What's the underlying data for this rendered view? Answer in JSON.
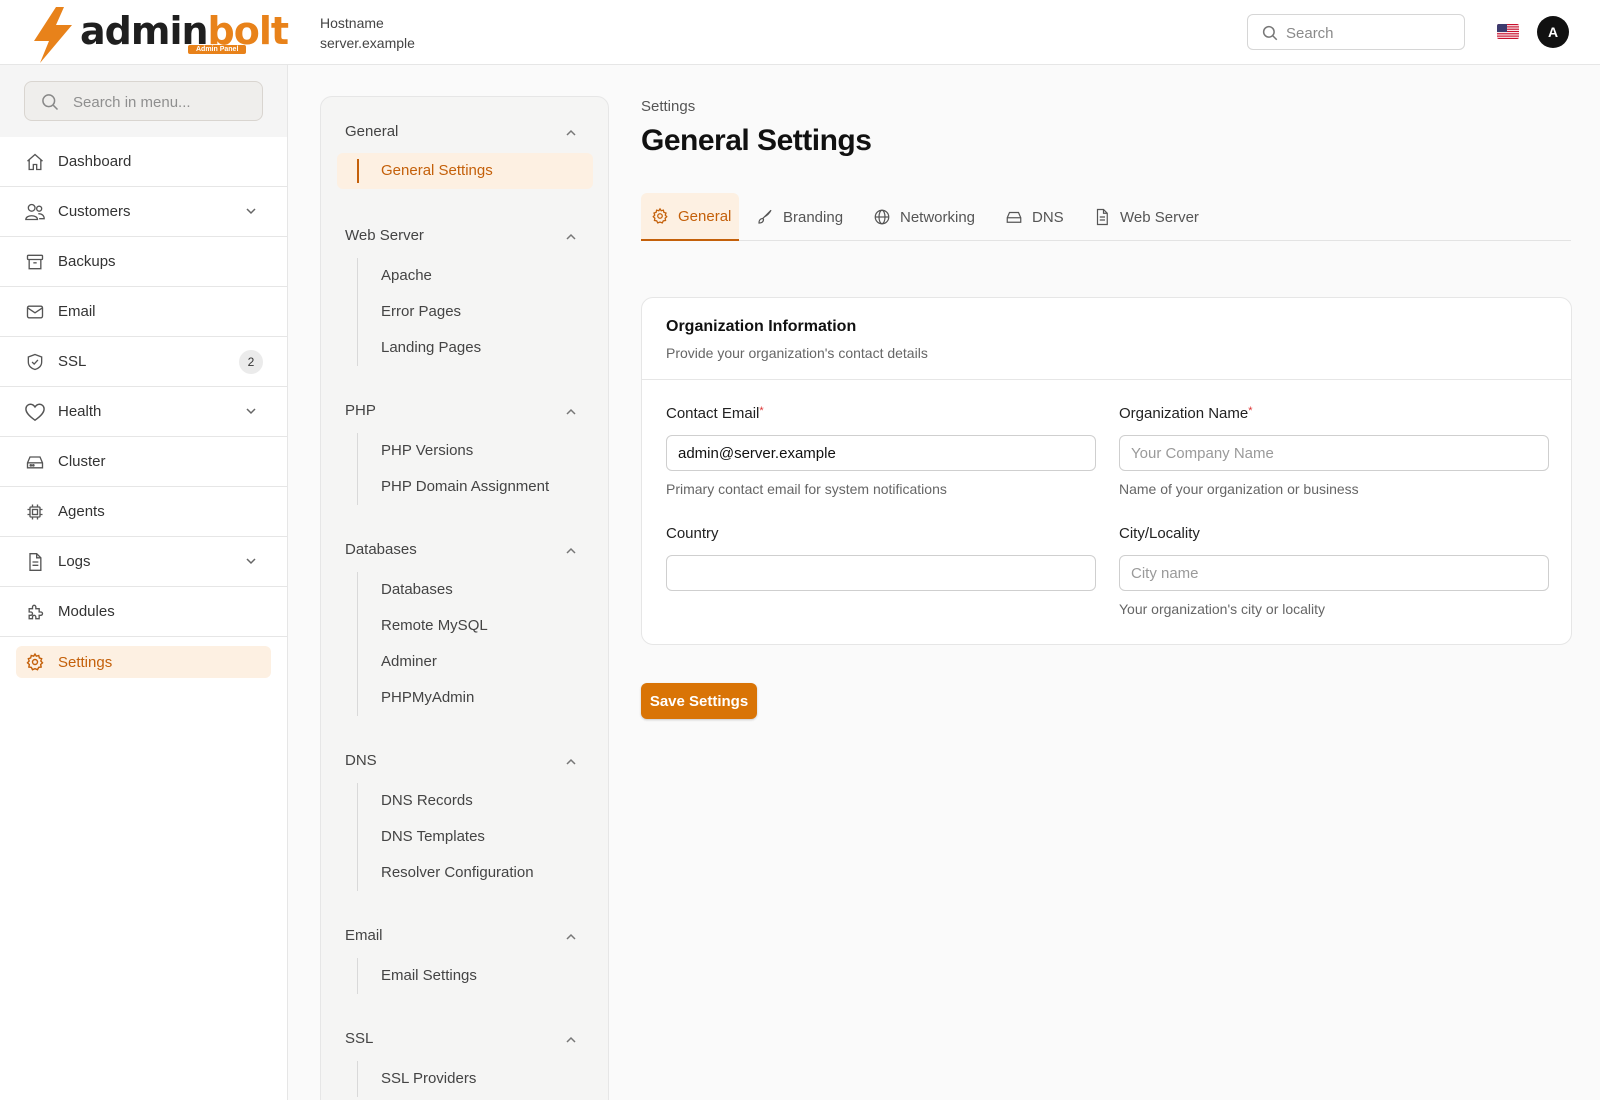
{
  "brand": {
    "name_part1": "admin",
    "name_part2": "bolt",
    "badge": "Admin Panel"
  },
  "header": {
    "hostname_label": "Hostname",
    "hostname_value": "server.example",
    "search_placeholder": "Search",
    "avatar_initial": "A",
    "language_flag": "us-flag-icon"
  },
  "sidebar": {
    "search_placeholder": "Search in menu...",
    "items": [
      {
        "label": "Dashboard",
        "icon": "home-icon"
      },
      {
        "label": "Customers",
        "icon": "users-icon",
        "expandable": true
      },
      {
        "label": "Backups",
        "icon": "archive-icon"
      },
      {
        "label": "Email",
        "icon": "mail-icon"
      },
      {
        "label": "SSL",
        "icon": "shield-check-icon",
        "badge": "2"
      },
      {
        "label": "Health",
        "icon": "heart-icon",
        "expandable": true
      },
      {
        "label": "Cluster",
        "icon": "server-icon"
      },
      {
        "label": "Agents",
        "icon": "cpu-icon"
      },
      {
        "label": "Logs",
        "icon": "document-icon",
        "expandable": true
      },
      {
        "label": "Modules",
        "icon": "puzzle-icon"
      },
      {
        "label": "Settings",
        "icon": "gear-icon",
        "active": true
      }
    ]
  },
  "subnav": {
    "groups": [
      {
        "title": "General",
        "items": [
          "General Settings"
        ],
        "active_item": "General Settings"
      },
      {
        "title": "Web Server",
        "items": [
          "Apache",
          "Error Pages",
          "Landing Pages"
        ]
      },
      {
        "title": "PHP",
        "items": [
          "PHP Versions",
          "PHP Domain Assignment"
        ]
      },
      {
        "title": "Databases",
        "items": [
          "Databases",
          "Remote MySQL",
          "Adminer",
          "PHPMyAdmin"
        ]
      },
      {
        "title": "DNS",
        "items": [
          "DNS Records",
          "DNS Templates",
          "Resolver Configuration"
        ]
      },
      {
        "title": "Email",
        "items": [
          "Email Settings"
        ]
      },
      {
        "title": "SSL",
        "items": [
          "SSL Providers"
        ]
      }
    ]
  },
  "main": {
    "breadcrumb": "Settings",
    "title": "General Settings",
    "tabs": [
      {
        "label": "General",
        "icon": "gear-icon",
        "active": true
      },
      {
        "label": "Branding",
        "icon": "brush-icon"
      },
      {
        "label": "Networking",
        "icon": "globe-icon"
      },
      {
        "label": "DNS",
        "icon": "server-drive-icon"
      },
      {
        "label": "Web Server",
        "icon": "document-icon"
      }
    ],
    "card": {
      "title": "Organization Information",
      "subtitle": "Provide your organization's contact details",
      "fields": {
        "contact_email": {
          "label": "Contact Email",
          "required": "*",
          "value": "admin@server.example",
          "placeholder": "",
          "hint": "Primary contact email for system notifications"
        },
        "org_name": {
          "label": "Organization Name",
          "required": "*",
          "value": "",
          "placeholder": "Your Company Name",
          "hint": "Name of your organization or business"
        },
        "country": {
          "label": "Country",
          "value": "",
          "placeholder": ""
        },
        "city": {
          "label": "City/Locality",
          "value": "",
          "placeholder": "City name",
          "hint": "Your organization's city or locality"
        }
      }
    },
    "save_label": "Save Settings"
  },
  "colors": {
    "accent": "#d97406",
    "accent_light": "#fdf0e2",
    "accent_text": "#c4600a",
    "brand_orange": "#e8821a"
  }
}
